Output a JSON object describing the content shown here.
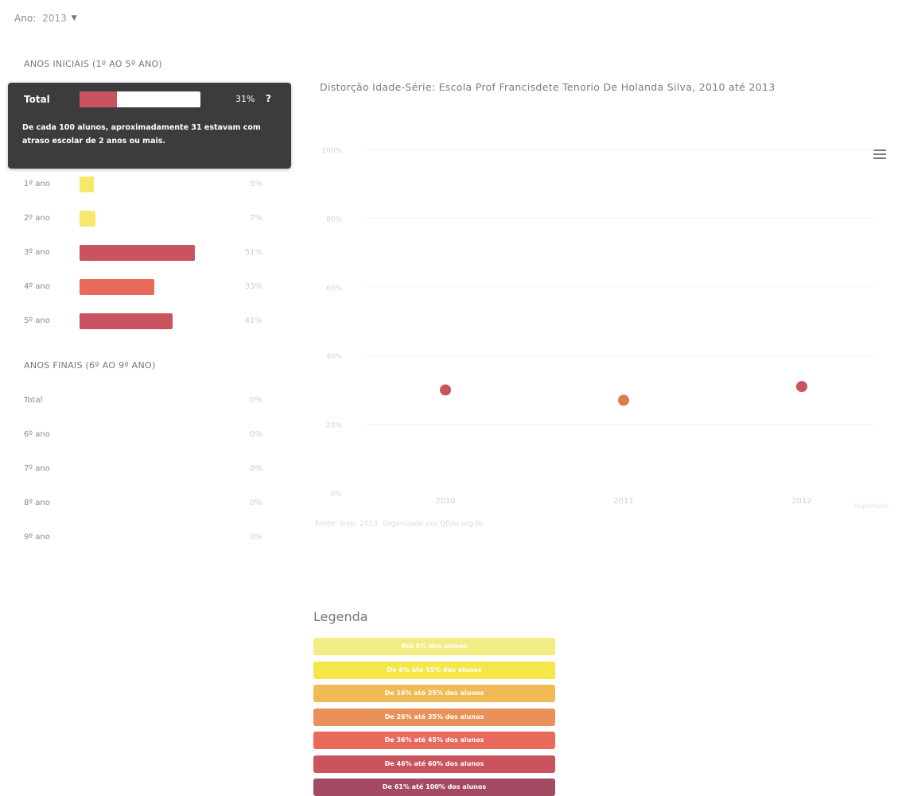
{
  "year_selector": {
    "label": "Ano:",
    "value": "2013"
  },
  "anos_iniciais": {
    "title": "ANOS INICIAIS (1º AO 5º ANO)",
    "tooltip": {
      "label": "Total",
      "value": "31%",
      "fraction": 0.31,
      "info_icon": "question-icon",
      "text": "De cada 100 alunos, aproximadamente 31 estavam com atraso escolar de 2 anos ou mais."
    },
    "rows": [
      {
        "label": "1º ano",
        "value": "5%",
        "fraction": 0.05,
        "color": "#f5e86a"
      },
      {
        "label": "2º ano",
        "value": "7%",
        "fraction": 0.07,
        "color": "#f5e86a"
      },
      {
        "label": "3º ano",
        "value": "51%",
        "fraction": 0.51,
        "color": "#c9535f"
      },
      {
        "label": "4º ano",
        "value": "33%",
        "fraction": 0.33,
        "color": "#e86a5a"
      },
      {
        "label": "5º ano",
        "value": "41%",
        "fraction": 0.41,
        "color": "#c9535f"
      }
    ]
  },
  "anos_finais": {
    "title": "ANOS FINAIS (6º AO 9º ANO)",
    "rows": [
      {
        "label": "Total",
        "value": "0%"
      },
      {
        "label": "6º ano",
        "value": "0%"
      },
      {
        "label": "7º ano",
        "value": "0%"
      },
      {
        "label": "8º ano",
        "value": "0%"
      },
      {
        "label": "9º ano",
        "value": "0%"
      }
    ]
  },
  "chart_header": {
    "title": "Distorção Idade-Série: Escola Prof Francisdete Tenorio De Holanda Silva, 2010 até 2013",
    "menu_icon": "hamburger-menu-icon"
  },
  "chart_data": {
    "type": "scatter",
    "title": "Distorção Idade-Série: Escola Prof Francisdete Tenorio De Holanda Silva, 2010 até 2013",
    "x": [
      "2010",
      "2011",
      "2012"
    ],
    "y": [
      30,
      27,
      31
    ],
    "point_colors": [
      "#c9535f",
      "#e07a55",
      "#c9535f"
    ],
    "yticks": [
      "0%",
      "20%",
      "40%",
      "60%",
      "80%",
      "100%"
    ],
    "ylim": [
      0,
      100
    ],
    "grid": true,
    "credits": "Highcharts"
  },
  "source_note": "Fonte: Inep, 2013. Organizado por QEdu.org.br.",
  "legend": {
    "title": "Legenda",
    "items": [
      {
        "label": "Até 5% dos alunos",
        "color": "#f2ec84"
      },
      {
        "label": "De 6% até 15% dos alunos",
        "color": "#f5e64a"
      },
      {
        "label": "De 16% até 25% dos alunos",
        "color": "#f0bb55"
      },
      {
        "label": "De 26% até 35% dos alunos",
        "color": "#e8925a"
      },
      {
        "label": "De 36% até 45% dos alunos",
        "color": "#e86a5a"
      },
      {
        "label": "De 46% até 60% dos alunos",
        "color": "#c9535f"
      },
      {
        "label": "De 61% até 100% dos alunos",
        "color": "#a44a63"
      }
    ]
  }
}
